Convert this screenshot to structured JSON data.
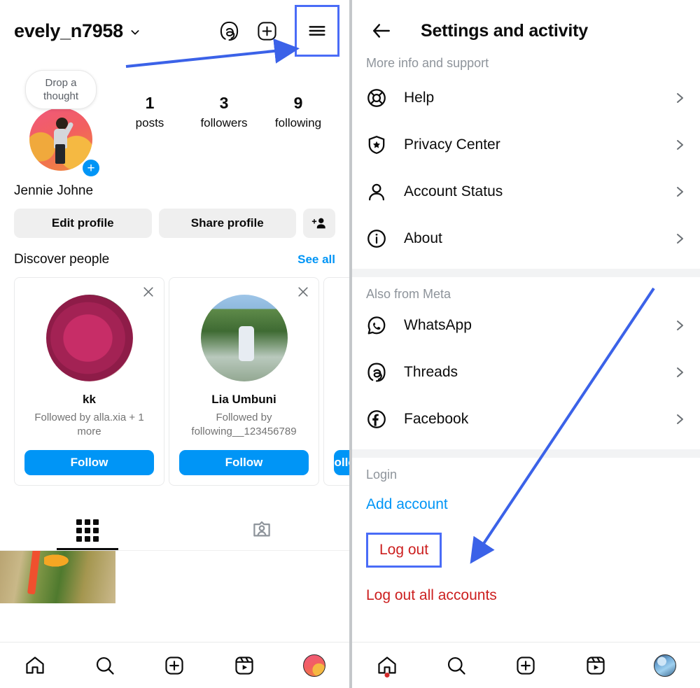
{
  "left": {
    "header": {
      "username": "evely_n7958",
      "chevron_icon": "chevron-down-icon",
      "threads_icon": "threads-icon",
      "add_icon": "plus-square-icon",
      "menu_icon": "hamburger-menu-icon"
    },
    "profile": {
      "note_bubble": "Drop a thought",
      "avatar_icon": "profile-avatar",
      "add_story_label": "+",
      "full_name": "Jennie Johne",
      "stats": [
        {
          "num": "1",
          "label": "posts"
        },
        {
          "num": "3",
          "label": "followers"
        },
        {
          "num": "9",
          "label": "following"
        }
      ],
      "edit_profile": "Edit profile",
      "share_profile": "Share profile",
      "add_person_icon": "add-person-icon"
    },
    "discover": {
      "title": "Discover people",
      "see_all": "See all",
      "cards": [
        {
          "name": "kk",
          "sub": "Followed by alla.xia + 1 more",
          "follow": "Follow",
          "close_icon": "close-icon"
        },
        {
          "name": "Lia Umbuni",
          "sub": "Followed by following__123456789",
          "follow": "Follow",
          "close_icon": "close-icon"
        },
        {
          "name": "",
          "sub": "",
          "follow": "Follow",
          "close_icon": "close-icon"
        }
      ]
    },
    "tabs": [
      {
        "icon": "grid-icon",
        "active": true
      },
      {
        "icon": "tagged-person-icon",
        "active": false
      }
    ],
    "bottom_nav": [
      {
        "icon": "home-icon"
      },
      {
        "icon": "search-icon"
      },
      {
        "icon": "plus-square-icon"
      },
      {
        "icon": "reels-icon"
      },
      {
        "icon": "profile-avatar-icon"
      }
    ]
  },
  "right": {
    "header": {
      "back_icon": "back-arrow-icon",
      "title": "Settings and activity"
    },
    "sections": [
      {
        "label": "More info and support",
        "items": [
          {
            "label": "Help",
            "icon": "lifebuoy-icon",
            "chevron": "chevron-right-icon"
          },
          {
            "label": "Privacy Center",
            "icon": "shield-star-icon",
            "chevron": "chevron-right-icon"
          },
          {
            "label": "Account Status",
            "icon": "person-icon",
            "chevron": "chevron-right-icon"
          },
          {
            "label": "About",
            "icon": "info-circle-icon",
            "chevron": "chevron-right-icon"
          }
        ]
      },
      {
        "label": "Also from Meta",
        "items": [
          {
            "label": "WhatsApp",
            "icon": "whatsapp-icon",
            "chevron": "chevron-right-icon"
          },
          {
            "label": "Threads",
            "icon": "threads-icon",
            "chevron": "chevron-right-icon"
          },
          {
            "label": "Facebook",
            "icon": "facebook-icon",
            "chevron": "chevron-right-icon"
          }
        ]
      }
    ],
    "login": {
      "label": "Login",
      "add_account": "Add account",
      "log_out": "Log out",
      "log_out_all": "Log out all accounts"
    },
    "bottom_nav": [
      {
        "icon": "home-icon"
      },
      {
        "icon": "search-icon"
      },
      {
        "icon": "plus-square-icon"
      },
      {
        "icon": "reels-icon"
      },
      {
        "icon": "profile-avatar-icon"
      }
    ]
  },
  "annotations": {
    "accent_blue": "#4a6cf7",
    "logout_red": "#cc1f1f",
    "link_blue": "#0095f6"
  }
}
